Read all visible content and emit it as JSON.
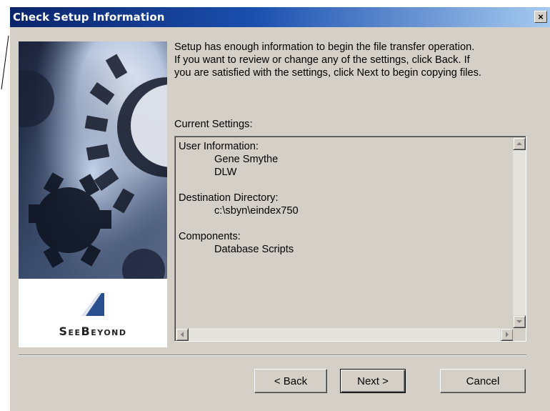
{
  "window": {
    "title": "Check Setup Information",
    "close_glyph": "×"
  },
  "side_panel": {
    "image": "gear-artwork",
    "logo_text": "SeeBeyond"
  },
  "info_text": "Setup has enough information to begin the file transfer operation.  If you want to review or change any of the settings, click Back.  If you are satisfied with the settings, click Next to begin copying files.",
  "current_settings_label": "Current Settings:",
  "settings": {
    "user_information_label": "User Information:",
    "user_name": "Gene Smythe",
    "company": "DLW",
    "destination_label": "Destination Directory:",
    "destination_path": "c:\\sbyn\\eindex750",
    "components_label": "Components:",
    "component": "Database Scripts"
  },
  "buttons": {
    "back": "< Back",
    "next": "Next >",
    "cancel": "Cancel"
  },
  "colors": {
    "titlebar_start": "#0a246a",
    "titlebar_end": "#a6caf0",
    "dialog_face": "#d4d0c8",
    "logo_blue": "#2a4f8f"
  }
}
